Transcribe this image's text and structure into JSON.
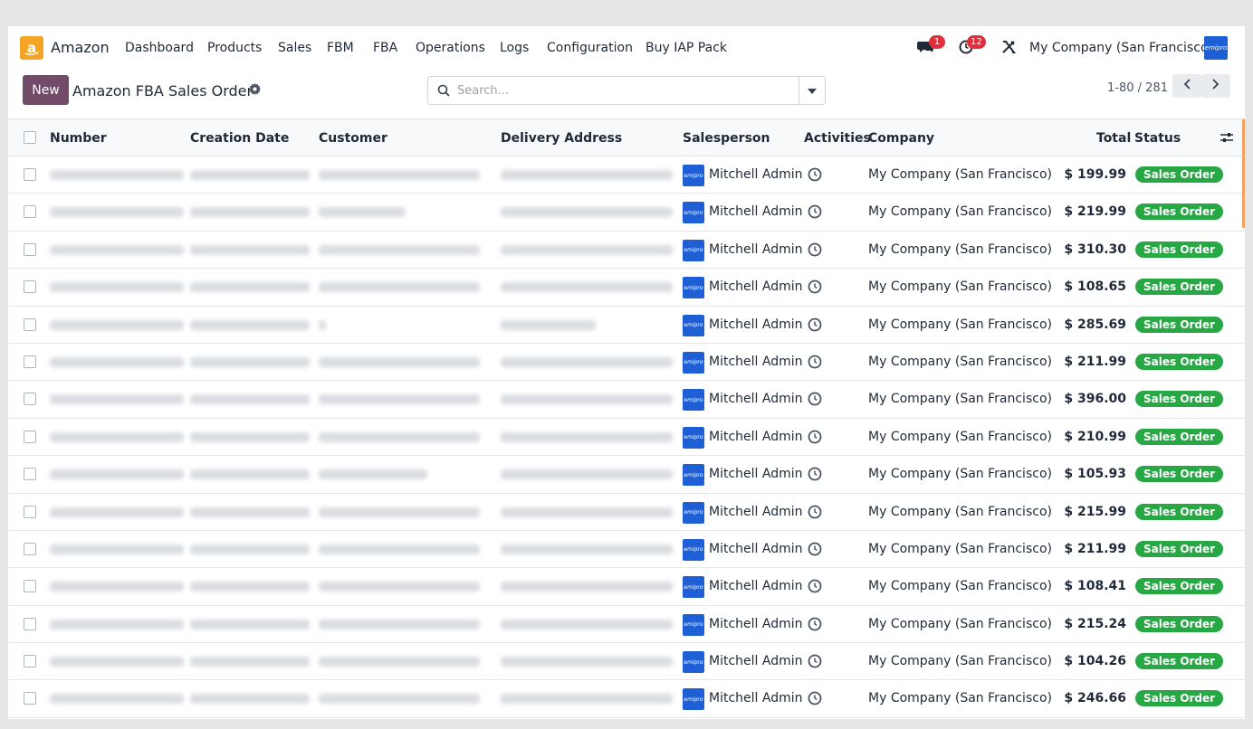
{
  "app": {
    "name": "Amazon",
    "brand_color": "#f5a524",
    "accent_color": "#714b67"
  },
  "nav": {
    "menu": [
      "Dashboard",
      "Products",
      "Sales",
      "FBM",
      "FBA",
      "Operations",
      "Logs",
      "Configuration",
      "Buy IAP Pack"
    ],
    "messages_badge": "1",
    "activities_badge": "12",
    "company": "My Company (San Francisco)",
    "avatar_text": "emipro"
  },
  "control": {
    "new_label": "New",
    "title": "Amazon FBA Sales Order",
    "search_placeholder": "Search...",
    "pager": "1-80 / 281"
  },
  "table": {
    "columns": [
      "Number",
      "Creation Date",
      "Customer",
      "Delivery Address",
      "Salesperson",
      "Activities",
      "Company",
      "Total",
      "Status"
    ],
    "rows": [
      {
        "salesperson": "Mitchell Admin",
        "company": "My Company (San Francisco)",
        "total": "$ 199.99",
        "status": "Sales Order"
      },
      {
        "salesperson": "Mitchell Admin",
        "company": "My Company (San Francisco)",
        "total": "$ 219.99",
        "status": "Sales Order"
      },
      {
        "salesperson": "Mitchell Admin",
        "company": "My Company (San Francisco)",
        "total": "$ 310.30",
        "status": "Sales Order"
      },
      {
        "salesperson": "Mitchell Admin",
        "company": "My Company (San Francisco)",
        "total": "$ 108.65",
        "status": "Sales Order"
      },
      {
        "salesperson": "Mitchell Admin",
        "company": "My Company (San Francisco)",
        "total": "$ 285.69",
        "status": "Sales Order"
      },
      {
        "salesperson": "Mitchell Admin",
        "company": "My Company (San Francisco)",
        "total": "$ 211.99",
        "status": "Sales Order"
      },
      {
        "salesperson": "Mitchell Admin",
        "company": "My Company (San Francisco)",
        "total": "$ 396.00",
        "status": "Sales Order"
      },
      {
        "salesperson": "Mitchell Admin",
        "company": "My Company (San Francisco)",
        "total": "$ 210.99",
        "status": "Sales Order"
      },
      {
        "salesperson": "Mitchell Admin",
        "company": "My Company (San Francisco)",
        "total": "$ 105.93",
        "status": "Sales Order"
      },
      {
        "salesperson": "Mitchell Admin",
        "company": "My Company (San Francisco)",
        "total": "$ 215.99",
        "status": "Sales Order"
      },
      {
        "salesperson": "Mitchell Admin",
        "company": "My Company (San Francisco)",
        "total": "$ 211.99",
        "status": "Sales Order"
      },
      {
        "salesperson": "Mitchell Admin",
        "company": "My Company (San Francisco)",
        "total": "$ 108.41",
        "status": "Sales Order"
      },
      {
        "salesperson": "Mitchell Admin",
        "company": "My Company (San Francisco)",
        "total": "$ 215.24",
        "status": "Sales Order"
      },
      {
        "salesperson": "Mitchell Admin",
        "company": "My Company (San Francisco)",
        "total": "$ 104.26",
        "status": "Sales Order"
      },
      {
        "salesperson": "Mitchell Admin",
        "company": "My Company (San Francisco)",
        "total": "$ 246.66",
        "status": "Sales Order"
      }
    ],
    "status_color": "#28a745"
  }
}
